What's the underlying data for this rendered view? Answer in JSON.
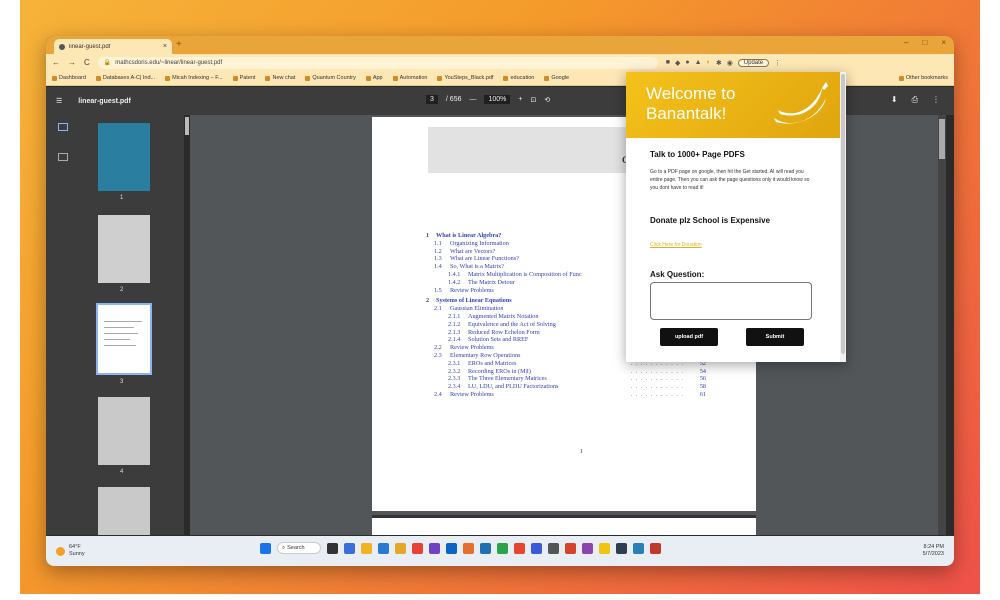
{
  "browser": {
    "tab_title": "linear-guest.pdf",
    "tab_close": "×",
    "new_tab": "+",
    "window_controls": [
      "–",
      "□",
      "×"
    ],
    "nav": [
      "←",
      "→",
      "C"
    ],
    "url": "mathcsdoris.edu/~linear/linear-guest.pdf",
    "update_label": "Update",
    "bookmarks": [
      "Dashboard",
      "Databases A-C| Ind...",
      "Micah Indexing – F...",
      "Patent",
      "New chat",
      "Quantum Country",
      "App",
      "Automation",
      "YouSteps_Black.pdf",
      "education",
      "Google"
    ],
    "other_bookmarks": "Other bookmarks"
  },
  "pdf": {
    "file_name": "linear-guest.pdf",
    "page_current": "3",
    "page_total": "/ 656",
    "zoom": "100%",
    "zoom_minus": "—",
    "zoom_plus": "+",
    "thumb_numbers": [
      "1",
      "2",
      "3",
      "4"
    ],
    "page_label": "1",
    "title_fragment": "C",
    "toc": [
      {
        "num": "1",
        "title": "What is Linear Algebra?",
        "page": "",
        "level": 0
      },
      {
        "num": "1.1",
        "title": "Organizing Information",
        "page": "",
        "level": 1
      },
      {
        "num": "1.2",
        "title": "What are Vectors?",
        "page": "",
        "level": 1
      },
      {
        "num": "1.3",
        "title": "What are Linear Functions?",
        "page": "",
        "level": 1
      },
      {
        "num": "1.4",
        "title": "So, What is a Matrix?",
        "page": "",
        "level": 1
      },
      {
        "num": "1.4.1",
        "title": "Matrix Multiplication is Composition of Func",
        "page": "",
        "level": 2
      },
      {
        "num": "1.4.2",
        "title": "The Matrix Detour",
        "page": "",
        "level": 2
      },
      {
        "num": "1.5",
        "title": "Review Problems",
        "page": "",
        "level": 1
      },
      {
        "num": "2",
        "title": "Systems of Linear Equations",
        "page": "",
        "level": 0
      },
      {
        "num": "2.1",
        "title": "Gaussian Elimination",
        "page": "",
        "level": 1
      },
      {
        "num": "2.1.1",
        "title": "Augmented Matrix Notation",
        "page": "",
        "level": 2
      },
      {
        "num": "2.1.2",
        "title": "Equivalence and the Act of Solving",
        "page": "",
        "level": 2
      },
      {
        "num": "2.1.3",
        "title": "Reduced Row Echelon Form",
        "page": "",
        "level": 2
      },
      {
        "num": "2.1.4",
        "title": "Solution Sets and RREF",
        "page": "45",
        "level": 2
      },
      {
        "num": "2.2",
        "title": "Review Problems",
        "page": "48",
        "level": 1
      },
      {
        "num": "2.3",
        "title": "Elementary Row Operations",
        "page": "52",
        "level": 1
      },
      {
        "num": "2.3.1",
        "title": "EROs and Matrices",
        "page": "52",
        "level": 2
      },
      {
        "num": "2.3.2",
        "title": "Recording EROs in (M|I)",
        "page": "54",
        "level": 2
      },
      {
        "num": "2.3.3",
        "title": "The Three Elementary Matrices",
        "page": "56",
        "level": 2
      },
      {
        "num": "2.3.4",
        "title": "LU, LDU, and PLDU Factorizations",
        "page": "58",
        "level": 2
      },
      {
        "num": "2.4",
        "title": "Review Problems",
        "page": "61",
        "level": 1
      }
    ]
  },
  "popup": {
    "welcome": "Welcome to Banantalk!",
    "heading1": "Talk to 1000+ Page PDFS",
    "desc": "Go to a PDF page on google, then hit the Get started. AI will read you entire page. Then you can ask the page questions only it would know so you dont have to read it!",
    "heading2": "Donate plz School is Expensive",
    "donate_link": "Click Here for Donation",
    "ask_label": "Ask Question:",
    "upload_button": "upload pdf",
    "submit_button": "Submit"
  },
  "taskbar": {
    "weather_temp": "64°F",
    "weather_desc": "Sunny",
    "search_label": "Search",
    "time": "8:24 PM",
    "date": "5/7/2023"
  },
  "colors": {
    "popup_accent": "#f4c21b",
    "toc_link": "#3340b8",
    "donate_link": "#d9b41a"
  }
}
